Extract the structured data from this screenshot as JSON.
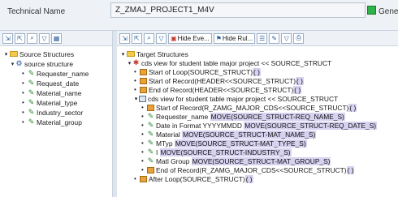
{
  "header": {
    "label": "Technical Name",
    "value": "Z_ZMAJ_PROJECT1_M4V",
    "right_label": "Genera"
  },
  "left_toolbar": {
    "icons": [
      "expand-all-icon",
      "collapse-icon",
      "find-icon",
      "filter-icon",
      "layout-icon"
    ]
  },
  "source_tree": {
    "root": "Source Structures",
    "structure": "source structure",
    "fields": [
      "Requester_name",
      "Request_date",
      "Material_name",
      "Material_type",
      "Industry_sector",
      "Material_group"
    ]
  },
  "right_toolbar": {
    "hide_events": "Hide Eve...",
    "hide_rules": "Hide Rul..."
  },
  "target_tree": {
    "root": "Target Structures",
    "view1": "cds view for student table major project << SOURCE_STRUCT",
    "start_loop_label": "Start of Loop",
    "start_loop_code": "(SOURCE_STRUCT)",
    "start_loop_tail": "( )",
    "start_rec_label": "Start of Record",
    "start_rec_code": "(HEADER<<SOURCE_STRUCT)",
    "start_rec_tail": "( )",
    "end_rec_label": "End of Record",
    "end_rec_code": "(HEADER<<SOURCE_STRUCT)",
    "end_rec_tail": "( )",
    "view2": "cds view for student table major project << SOURCE_STRUCT",
    "sub_start_rec_label": "Start of Record",
    "sub_start_rec_code": "(R_ZAMG_MAJOR_CDS<<SOURCE_STRUCT)",
    "sub_start_rec_tail": "( )",
    "mappings": [
      {
        "label": "Requester_name",
        "code": "MOVE(SOURCE_STRUCT-REQ_NAME_S)"
      },
      {
        "label": "Date in Format YYYYMMDD",
        "code": "MOVE(SOURCE_STRUCT-REQ_DATE_S)"
      },
      {
        "label": "Material",
        "code": "MOVE(SOURCE_STRUCT-MAT_NAME_S)"
      },
      {
        "label": "MTyp",
        "code": "MOVE(SOURCE_STRUCT-MAT_TYPE_S)"
      },
      {
        "label": "I",
        "code": "MOVE(SOURCE_STRUCT-INDUSTRY_S)"
      },
      {
        "label": "Matl Group",
        "code": "MOVE(SOURCE_STRUCT-MAT_GROUP_S)"
      }
    ],
    "sub_end_rec_label": "End of Record",
    "sub_end_rec_code": "(R_ZAMG_MAJOR_CDS<<SOURCE_STRUCT)",
    "sub_end_rec_tail": "( )",
    "after_loop_label": "After Loop",
    "after_loop_code": "(SOURCE_STRUCT)",
    "after_loop_tail": "( )"
  }
}
